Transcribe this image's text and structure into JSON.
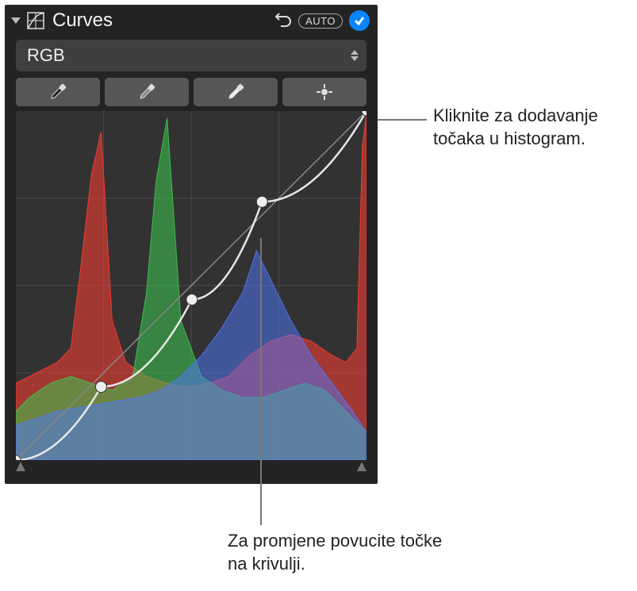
{
  "header": {
    "title": "Curves",
    "auto_label": "AUTO"
  },
  "channel": {
    "selected": "RGB"
  },
  "callouts": {
    "add_point": "Kliknite za dodavanje točaka u histogram.",
    "drag_point": "Za promjene povucite točke na krivulji."
  },
  "icons": {
    "disclosure": "disclosure-triangle",
    "curves": "curves-icon",
    "reset": "undo-icon",
    "check": "checkmark-icon",
    "eyedropper_black": "eyedropper-black-icon",
    "eyedropper_gray": "eyedropper-gray-icon",
    "eyedropper_white": "eyedropper-white-icon",
    "add_point": "add-point-target-icon",
    "stepper": "stepper-icon"
  },
  "chart_data": {
    "type": "area",
    "title": "",
    "xlabel": "",
    "ylabel": "",
    "xlim": [
      0,
      255
    ],
    "ylim": [
      0,
      100
    ],
    "grid": true,
    "diagonal_reference": true,
    "curve_points_xy": [
      [
        0,
        0
      ],
      [
        62,
        21
      ],
      [
        128,
        46
      ],
      [
        179,
        74
      ],
      [
        255,
        100
      ]
    ],
    "series": [
      {
        "name": "Red",
        "color": "#ff3c32",
        "x": [
          0,
          10,
          20,
          30,
          40,
          48,
          55,
          62,
          70,
          80,
          95,
          110,
          125,
          140,
          155,
          170,
          185,
          200,
          215,
          230,
          240,
          248,
          252,
          255
        ],
        "y": [
          22,
          24,
          26,
          28,
          32,
          58,
          82,
          94,
          40,
          28,
          24,
          22,
          21,
          22,
          24,
          30,
          34,
          36,
          34,
          30,
          28,
          32,
          90,
          99
        ]
      },
      {
        "name": "Green",
        "color": "#3cc850",
        "x": [
          0,
          10,
          25,
          40,
          55,
          70,
          85,
          95,
          102,
          110,
          120,
          135,
          150,
          165,
          180,
          195,
          210,
          225,
          240,
          255
        ],
        "y": [
          14,
          18,
          22,
          24,
          22,
          20,
          24,
          48,
          80,
          98,
          40,
          24,
          20,
          18,
          18,
          20,
          22,
          20,
          14,
          8
        ]
      },
      {
        "name": "Blue",
        "color": "#5078ff",
        "x": [
          0,
          15,
          30,
          45,
          60,
          75,
          90,
          105,
          120,
          135,
          150,
          165,
          175,
          185,
          200,
          215,
          230,
          245,
          255
        ],
        "y": [
          10,
          12,
          14,
          15,
          16,
          17,
          18,
          20,
          24,
          30,
          38,
          48,
          60,
          52,
          40,
          30,
          22,
          14,
          8
        ]
      }
    ],
    "slider_low": 0,
    "slider_high": 255
  }
}
